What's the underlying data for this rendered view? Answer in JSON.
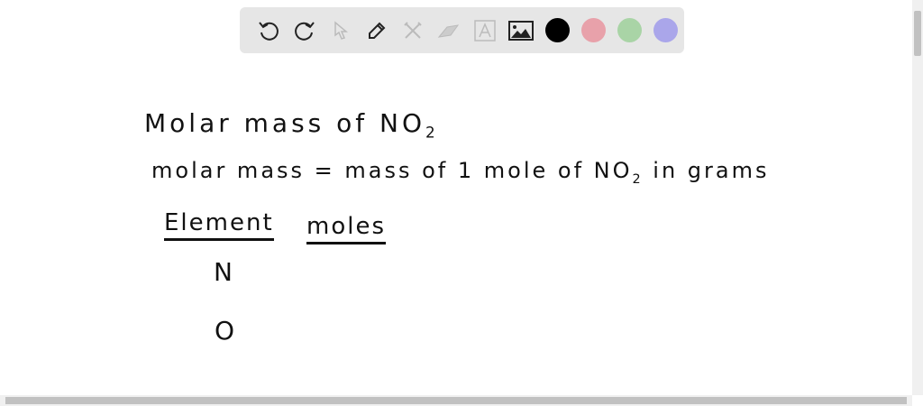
{
  "toolbar": {
    "tools": [
      "undo-icon",
      "redo-icon",
      "select-icon",
      "pen-icon",
      "tools-icon",
      "eraser-icon",
      "text-icon",
      "image-icon"
    ],
    "colors": [
      "#000000",
      "#e8a1aa",
      "#a9d4a6",
      "#aaa6ea"
    ]
  },
  "canvas": {
    "line1": "Molar mass of NO",
    "line1_sub": "2",
    "line2a": "molar mass = mass of  1 mole of NO",
    "line2_sub": "2",
    "line2b": " in grams",
    "header_element": "Element",
    "header_moles": "moles",
    "element_n": "N",
    "element_o": "O"
  }
}
